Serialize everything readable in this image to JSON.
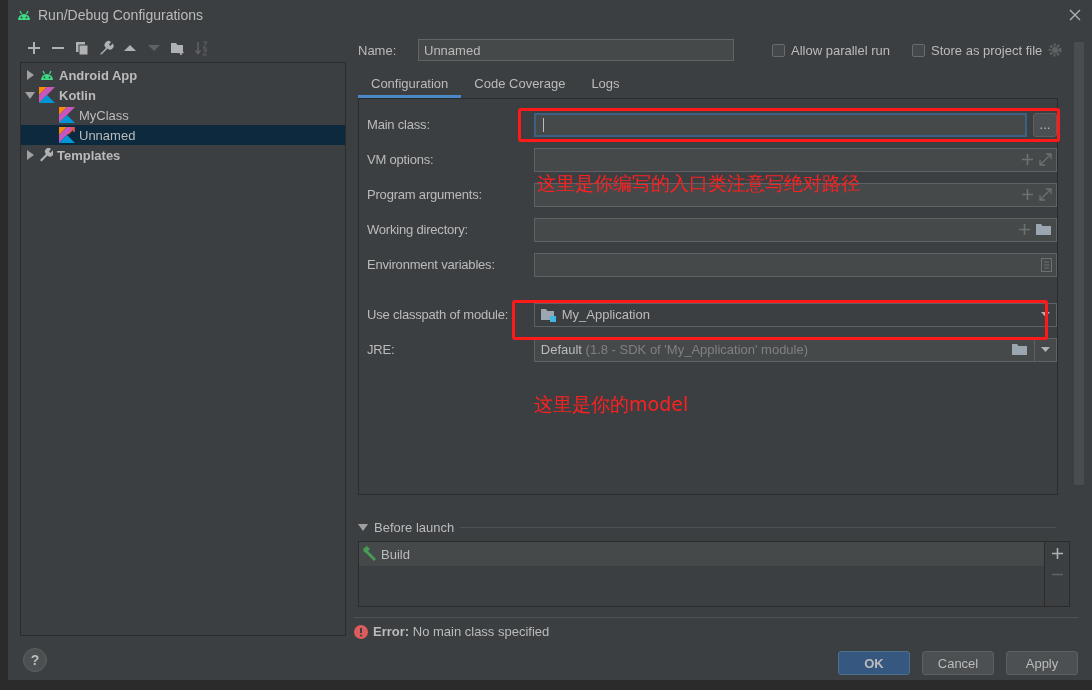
{
  "window": {
    "title": "Run/Debug Configurations"
  },
  "toolbar": [
    {
      "kind": "add",
      "disabled": false
    },
    {
      "kind": "remove",
      "disabled": false
    },
    {
      "kind": "copy",
      "disabled": false
    },
    {
      "kind": "wrench",
      "disabled": false
    },
    {
      "kind": "up",
      "disabled": false
    },
    {
      "kind": "down",
      "disabled": true
    },
    {
      "kind": "folder",
      "disabled": false
    },
    {
      "kind": "sort",
      "disabled": true
    }
  ],
  "tree": [
    {
      "label": "Android App",
      "kind": "android",
      "expanded": false,
      "selected": false
    },
    {
      "label": "Kotlin",
      "kind": "kotlin",
      "expanded": true,
      "selected": false,
      "children": [
        {
          "label": "MyClass",
          "kind": "kotlin",
          "selected": false
        },
        {
          "label": "Unnamed",
          "kind": "kotlin-new",
          "selected": true
        }
      ]
    },
    {
      "label": "Templates",
      "kind": "wrench",
      "expanded": false,
      "selected": false
    }
  ],
  "help": "?",
  "name": {
    "label": "Name:",
    "value": "Unnamed"
  },
  "options": [
    {
      "label": "Allow parallel run",
      "checked": false
    },
    {
      "label": "Store as project file",
      "checked": false
    }
  ],
  "tabs": [
    {
      "label": "Configuration",
      "selected": true
    },
    {
      "label": "Code Coverage",
      "selected": false
    },
    {
      "label": "Logs",
      "selected": false
    }
  ],
  "fields": [
    {
      "kind": "class",
      "label": "Main class:",
      "focused": true,
      "browse": "..."
    },
    {
      "kind": "expand",
      "label": "VM options:"
    },
    {
      "kind": "expand",
      "label": "Program arguments:"
    },
    {
      "kind": "folder",
      "label": "Working directory:"
    },
    {
      "kind": "list",
      "label": "Environment variables:"
    },
    {
      "kind": "module",
      "label": "Use classpath of module:",
      "value": "My_Application"
    },
    {
      "kind": "jre",
      "label": "JRE:",
      "value": "Default",
      "hint": "(1.8 - SDK of 'My_Application' module)"
    }
  ],
  "before_launch": {
    "label": "Before launch",
    "expanded": true,
    "tasks": [
      {
        "label": "Build",
        "selected": true
      }
    ]
  },
  "error": "**Error:** No main class specified",
  "buttons": [
    {
      "label": "OK",
      "default": true
    },
    {
      "label": "Cancel",
      "default": false
    },
    {
      "label": "Apply",
      "default": false
    }
  ],
  "annotations": [
    {
      "kind": "box"
    },
    {
      "kind": "note",
      "text": "这里是你编写的入口类注意写绝对路径"
    },
    {
      "kind": "box"
    },
    {
      "kind": "note",
      "text": "这里是你的model"
    }
  ]
}
